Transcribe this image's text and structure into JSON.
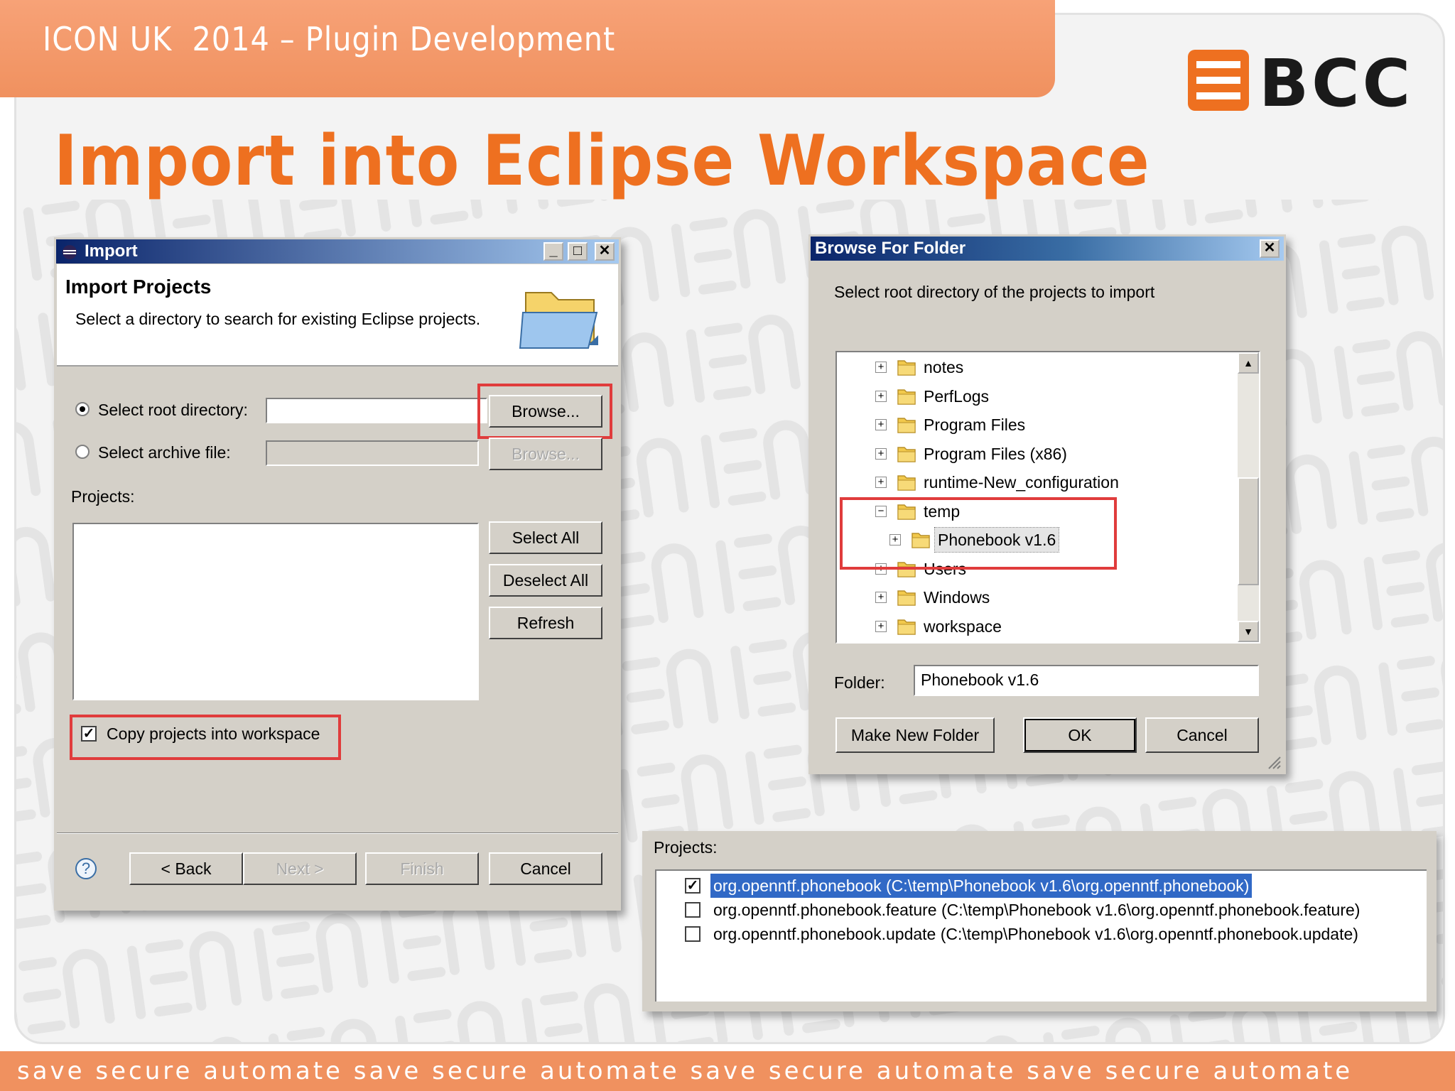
{
  "slide": {
    "header": "ICON UK  2014 – Plugin Development",
    "title": "Import into Eclipse Workspace",
    "logo_text": "BCC",
    "footer": "save secure automate save secure automate save secure automate save secure automate",
    "accent_color": "#ee7020"
  },
  "import_dialog": {
    "title": "Import",
    "heading": "Import Projects",
    "description": "Select a directory to search for existing Eclipse projects.",
    "root_dir_label": "Select root directory:",
    "root_dir_value": "",
    "root_dir_selected": true,
    "browse_label": "Browse...",
    "archive_label": "Select archive file:",
    "archive_browse_label": "Browse...",
    "projects_label": "Projects:",
    "select_all": "Select All",
    "deselect_all": "Deselect All",
    "refresh": "Refresh",
    "copy_label": "Copy projects into workspace",
    "copy_checked": true,
    "help": "?",
    "back": "< Back",
    "next": "Next >",
    "finish": "Finish",
    "cancel": "Cancel"
  },
  "browse_dialog": {
    "title": "Browse For Folder",
    "instruction": "Select root directory of the projects to import",
    "tree": [
      {
        "name": "notes",
        "expander": "+"
      },
      {
        "name": "PerfLogs",
        "expander": "+"
      },
      {
        "name": "Program Files",
        "expander": "+"
      },
      {
        "name": "Program Files (x86)",
        "expander": "+"
      },
      {
        "name": "runtime-New_configuration",
        "expander": "+"
      },
      {
        "name": "temp",
        "expander": "−"
      },
      {
        "name": "Phonebook v1.6",
        "expander": "+"
      },
      {
        "name": "Users",
        "expander": "+"
      },
      {
        "name": "Windows",
        "expander": "+"
      },
      {
        "name": "workspace",
        "expander": "+"
      }
    ],
    "folder_label": "Folder:",
    "folder_value": "Phonebook v1.6",
    "make_new_folder": "Make New Folder",
    "ok": "OK",
    "cancel": "Cancel"
  },
  "projects_panel": {
    "label": "Projects:",
    "items": [
      {
        "text": "org.openntf.phonebook (C:\\temp\\Phonebook v1.6\\org.openntf.phonebook)",
        "checked": true
      },
      {
        "text": "org.openntf.phonebook.feature (C:\\temp\\Phonebook v1.6\\org.openntf.phonebook.feature)",
        "checked": false
      },
      {
        "text": "org.openntf.phonebook.update (C:\\temp\\Phonebook v1.6\\org.openntf.phonebook.update)",
        "checked": false
      }
    ]
  }
}
